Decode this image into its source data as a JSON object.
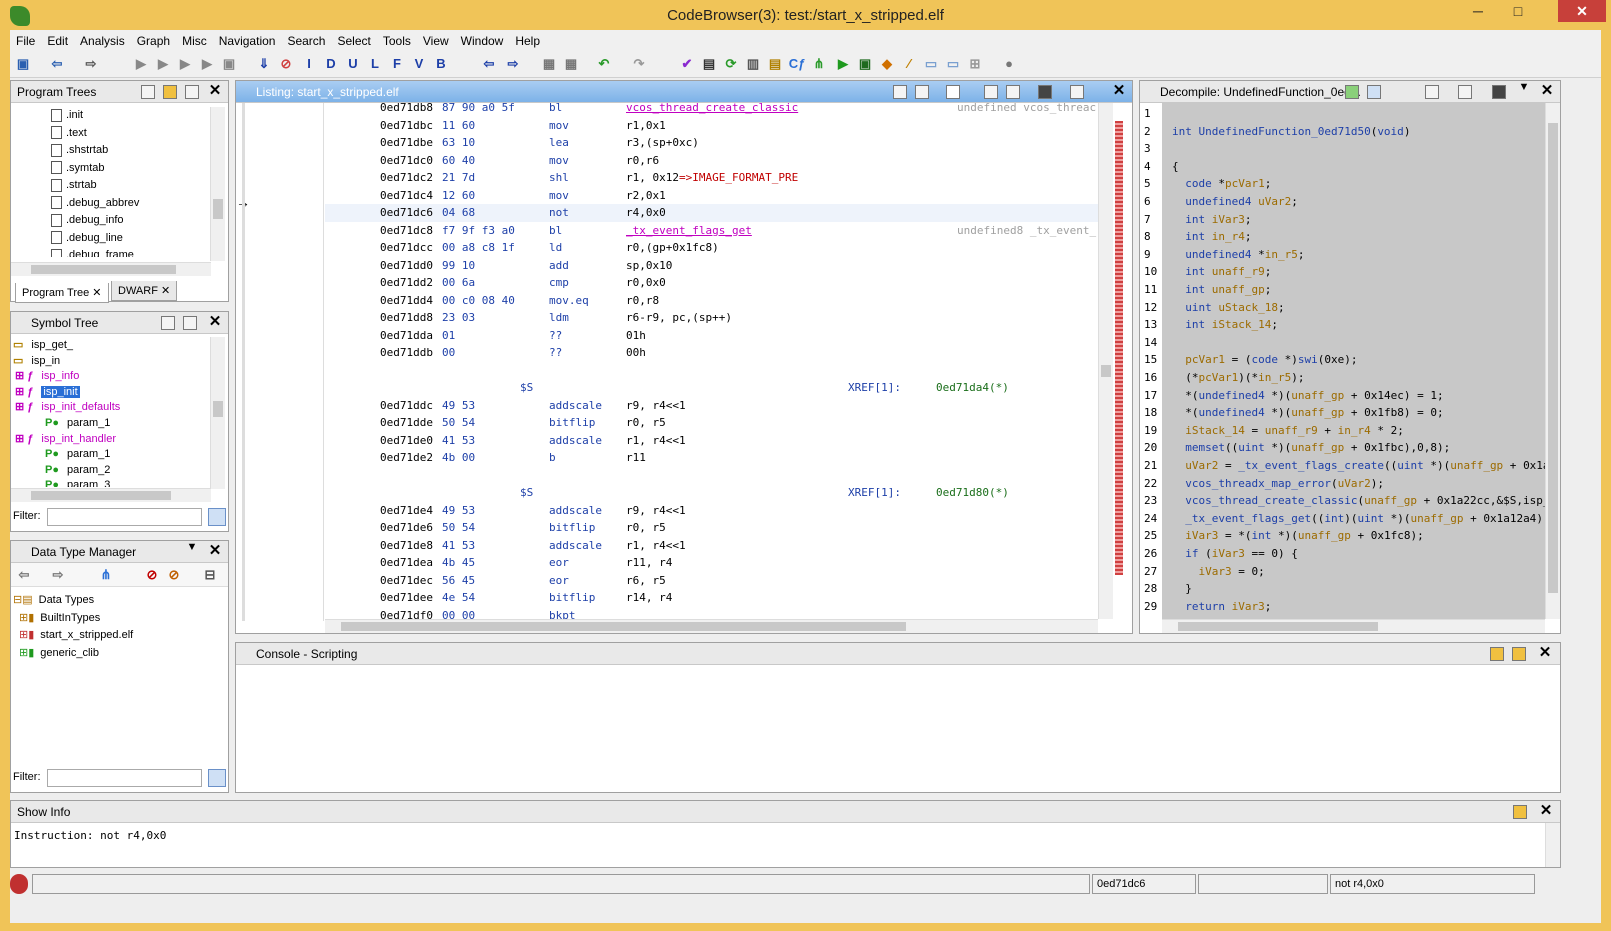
{
  "window": {
    "title": "CodeBrowser(3): test:/start_x_stripped.elf",
    "minimize": "─",
    "maximize": "□",
    "close": "✕"
  },
  "menu": [
    "File",
    "Edit",
    "Analysis",
    "Graph",
    "Misc",
    "Navigation",
    "Search",
    "Select",
    "Tools",
    "View",
    "Window",
    "Help"
  ],
  "toolbar": {
    "letters": [
      "I",
      "D",
      "U",
      "L",
      "F",
      "V",
      "B"
    ]
  },
  "program_trees": {
    "title": "Program Trees",
    "items": [
      ".init",
      ".text",
      ".shstrtab",
      ".symtab",
      ".strtab",
      ".debug_abbrev",
      ".debug_info",
      ".debug_line",
      ".debug_frame"
    ],
    "tabs": [
      "Program Tree",
      "DWARF"
    ]
  },
  "symbol_tree": {
    "title": "Symbol Tree",
    "items": [
      {
        "label": "isp_get_",
        "kind": "folder"
      },
      {
        "label": "isp_in",
        "kind": "folder"
      },
      {
        "label": "isp_info",
        "kind": "function"
      },
      {
        "label": "isp_init",
        "kind": "function-selected"
      },
      {
        "label": "isp_init_defaults",
        "kind": "function"
      },
      {
        "label": "param_1",
        "kind": "param"
      },
      {
        "label": "isp_int_handler",
        "kind": "function"
      },
      {
        "label": "param_1",
        "kind": "param"
      },
      {
        "label": "param_2",
        "kind": "param"
      },
      {
        "label": "param_3",
        "kind": "param"
      }
    ],
    "filter_label": "Filter:"
  },
  "data_type_manager": {
    "title": "Data Type Manager",
    "items": [
      "Data Types",
      "BuiltInTypes",
      "start_x_stripped.elf",
      "generic_clib"
    ],
    "filter_label": "Filter:"
  },
  "listing": {
    "title": "Listing:  start_x_stripped.elf",
    "rows": [
      {
        "addr": "0ed71db8",
        "bytes": "87 90 a0 5f",
        "mnem": "bl",
        "ops": "vcos_thread_create_classic",
        "ops_kind": "fn",
        "cmt": "undefined vcos_threac"
      },
      {
        "addr": "0ed71dbc",
        "bytes": "11 60",
        "mnem": "mov",
        "ops": "r1,0x1"
      },
      {
        "addr": "0ed71dbe",
        "bytes": "63 10",
        "mnem": "lea",
        "ops": "r3,(sp+0xc)"
      },
      {
        "addr": "0ed71dc0",
        "bytes": "60 40",
        "mnem": "mov",
        "ops": "r0,r6"
      },
      {
        "addr": "0ed71dc2",
        "bytes": "21 7d",
        "mnem": "shl",
        "ops": "r1, 0x12=>IMAGE_FORMAT_PRE",
        "ops_kind": "ref"
      },
      {
        "addr": "0ed71dc4",
        "bytes": "12 60",
        "mnem": "mov",
        "ops": "r2,0x1"
      },
      {
        "addr": "0ed71dc6",
        "bytes": "04 68",
        "mnem": "not",
        "ops": "r4,0x0",
        "current": true
      },
      {
        "addr": "0ed71dc8",
        "bytes": "f7 9f f3 a0",
        "mnem": "bl",
        "ops": "_tx_event_flags_get",
        "ops_kind": "fn",
        "cmt": "undefined8 _tx_event_"
      },
      {
        "addr": "0ed71dcc",
        "bytes": "00 a8 c8 1f",
        "mnem": "ld",
        "ops": "r0,(gp+0x1fc8)"
      },
      {
        "addr": "0ed71dd0",
        "bytes": "99 10",
        "mnem": "add",
        "ops": "sp,0x10"
      },
      {
        "addr": "0ed71dd2",
        "bytes": "00 6a",
        "mnem": "cmp",
        "ops": "r0,0x0"
      },
      {
        "addr": "0ed71dd4",
        "bytes": "00 c0 08 40",
        "mnem": "mov.eq",
        "ops": "r0,r8"
      },
      {
        "addr": "0ed71dd8",
        "bytes": "23 03",
        "mnem": "ldm",
        "ops": "r6-r9, pc,(sp++)"
      },
      {
        "addr": "0ed71dda",
        "bytes": "01",
        "mnem": "??",
        "ops": "01h"
      },
      {
        "addr": "0ed71ddb",
        "bytes": "00",
        "mnem": "??",
        "ops": "00h"
      },
      {
        "blank": true
      },
      {
        "label": "$S",
        "xref": "XREF[1]:",
        "xaddr": "0ed71da4(*)"
      },
      {
        "addr": "0ed71ddc",
        "bytes": "49 53",
        "mnem": "addscale",
        "ops": "r9, r4<<1"
      },
      {
        "addr": "0ed71dde",
        "bytes": "50 54",
        "mnem": "bitflip",
        "ops": "r0, r5"
      },
      {
        "addr": "0ed71de0",
        "bytes": "41 53",
        "mnem": "addscale",
        "ops": "r1, r4<<1"
      },
      {
        "addr": "0ed71de2",
        "bytes": "4b 00",
        "mnem": "b",
        "ops": "r11"
      },
      {
        "blank": true
      },
      {
        "label": "$S",
        "xref": "XREF[1]:",
        "xaddr": "0ed71d80(*)"
      },
      {
        "addr": "0ed71de4",
        "bytes": "49 53",
        "mnem": "addscale",
        "ops": "r9, r4<<1"
      },
      {
        "addr": "0ed71de6",
        "bytes": "50 54",
        "mnem": "bitflip",
        "ops": "r0, r5"
      },
      {
        "addr": "0ed71de8",
        "bytes": "41 53",
        "mnem": "addscale",
        "ops": "r1, r4<<1"
      },
      {
        "addr": "0ed71dea",
        "bytes": "4b 45",
        "mnem": "eor",
        "ops": "r11, r4"
      },
      {
        "addr": "0ed71dec",
        "bytes": "56 45",
        "mnem": "eor",
        "ops": "r6, r5"
      },
      {
        "addr": "0ed71dee",
        "bytes": "4e 54",
        "mnem": "bitflip",
        "ops": "r14, r4"
      },
      {
        "addr": "0ed71df0",
        "bytes": "00 00",
        "mnem": "bkpt",
        "ops": ""
      }
    ]
  },
  "decompile": {
    "title": "Decompile: UndefinedFunction_0ed...",
    "lines": [
      "",
      "int UndefinedFunction_0ed71d50(void)",
      "",
      "{",
      "  code *pcVar1;",
      "  undefined4 uVar2;",
      "  int iVar3;",
      "  int in_r4;",
      "  undefined4 *in_r5;",
      "  int unaff_r9;",
      "  int unaff_gp;",
      "  uint uStack_18;",
      "  int iStack_14;",
      "",
      "  pcVar1 = (code *)swi(0xe);",
      "  (*pcVar1)(*in_r5);",
      "  *(undefined4 *)(unaff_gp + 0x14ec) = 1;",
      "  *(undefined4 *)(unaff_gp + 0x1fb8) = 0;",
      "  iStack_14 = unaff_r9 + in_r4 * 2;",
      "  memset((uint *)(unaff_gp + 0x1fbc),0,8);",
      "  uVar2 = _tx_event_flags_create((uint *)(unaff_gp + 0x1a",
      "  vcos_threadx_map_error(uVar2);",
      "  vcos_thread_create_classic(unaff_gp + 0x1a22cc,&$S,isp_",
      "  _tx_event_flags_get((int)(uint *)(unaff_gp + 0x1a12a4),",
      "  iVar3 = *(int *)(unaff_gp + 0x1fc8);",
      "  if (iVar3 == 0) {",
      "    iVar3 = 0;",
      "  }",
      "  return iVar3;"
    ]
  },
  "console": {
    "title": "Console - Scripting"
  },
  "show_info": {
    "title": "Show Info",
    "text": "Instruction: not r4,0x0"
  },
  "statusbar": {
    "address": "0ed71dc6",
    "instruction": "not r4,0x0"
  }
}
